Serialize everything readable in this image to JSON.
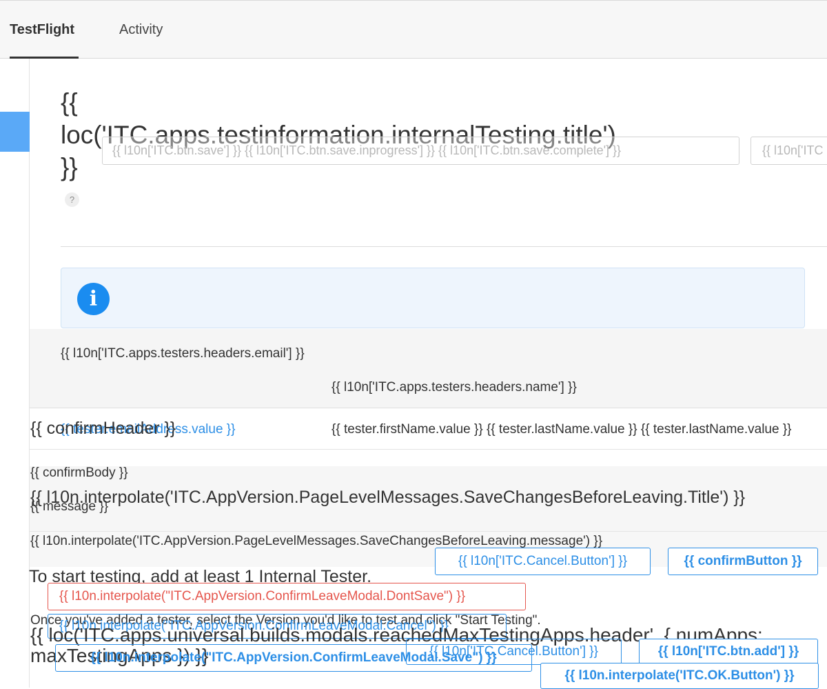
{
  "nav": {
    "tab_testflight": "TestFlight",
    "tab_activity": "Activity"
  },
  "page": {
    "title": "{{ loc('ITC.apps.testinformation.internalTesting.title') }}",
    "help": "?",
    "save_buttons": "{{ l10n['ITC.btn.save'] }} {{ l10n['ITC.btn.save.inprogress'] }} {{ l10n['ITC.btn.save.complete'] }}",
    "save_buttons_extra": "{{ l10n['ITC"
  },
  "info": {
    "icon": "i"
  },
  "table": {
    "header_email": "{{ l10n['ITC.apps.testers.headers.email'] }}",
    "header_name": "{{ l10n['ITC.apps.testers.headers.name'] }}",
    "row_email": "{{ tester.emailAddress.value }}",
    "row_name": "{{ tester.firstName.value }} {{ tester.lastName.value }} {{ tester.lastName.value }}"
  },
  "modals": {
    "confirm_header": "{{ confirmHeader }}",
    "confirm_body": "{{ confirmBody }}",
    "save_title": "{{ l10n.interpolate('ITC.AppVersion.PageLevelMessages.SaveChangesBeforeLeaving.Title') }}",
    "message": "{{ message }}",
    "save_message": "{{ l10n.interpolate('ITC.AppVersion.PageLevelMessages.SaveChangesBeforeLeaving.message') }}",
    "cancel_button": "{{ l10n['ITC.Cancel.Button'] }}",
    "confirm_button": "{{ confirmButton }}",
    "start_testing": "To start testing, add at least 1 Internal Tester.",
    "dont_save": "{{ l10n.interpolate(\"ITC.AppVersion.ConfirmLeaveModal.DontSave\") }}",
    "once_added": "Once you've added a tester, select the Version you'd like to test and click \"Start Testing\".",
    "cancel_leave": "{{ l10n.interpolate(\"ITC.AppVersion.ConfirmLeaveModal.Cancel\") }}",
    "max_apps_line1": "{{ loc('ITC.apps.universal.builds.modals.reachedMaxTestingApps.header', { numApps:",
    "max_apps_line2": "maxTestingApps }) }}",
    "cancel_button_2": "{{ l10n['ITC.Cancel.Button'] }}",
    "add_button": "{{ l10n['ITC.btn.add'] }}",
    "save_leave": "{{ l10n.interpolate(\"ITC.AppVersion.ConfirmLeaveModal.Save\") }}",
    "ok_button": "{{ l10n.interpolate('ITC.OK.Button') }}"
  },
  "colors": {
    "accent": "#2d8fe6",
    "danger": "#e5564d",
    "info_icon": "#1a8cf0",
    "sidebar_accent": "#5aa9f7"
  }
}
